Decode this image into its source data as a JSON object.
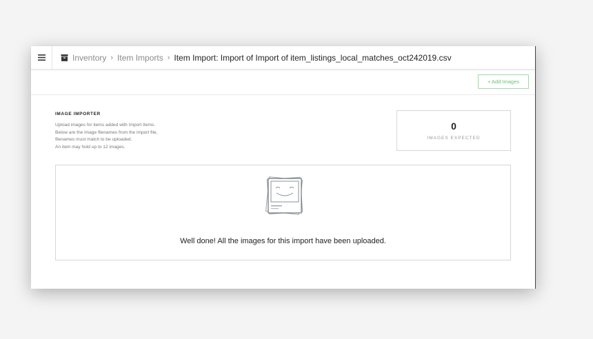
{
  "breadcrumb": {
    "items": [
      "Inventory",
      "Item Imports"
    ],
    "separator": "›",
    "current": "Item Import: Import of Import of item_listings_local_matches_oct242019.csv"
  },
  "icons": {
    "menu": "hamburger-menu-icon",
    "inventory": "inventory-box-icon",
    "empty_state": "photo-stack-icon"
  },
  "actions": {
    "add_images_label": "+ Add Images"
  },
  "importer": {
    "title": "IMAGE IMPORTER",
    "description": [
      "Upload images for items added with Import Items.",
      "Below are the image filenames from the import file,",
      "filenames must match to be uploaded.",
      "An item may hold up to 12 images."
    ]
  },
  "stats": {
    "count": "0",
    "label": "IMAGES EXPECTED"
  },
  "empty_state": {
    "message": "Well done! All the images for this import have been uploaded."
  },
  "colors": {
    "accent_green": "#6cc077",
    "text": "#222222",
    "muted": "#8a8a8a"
  }
}
